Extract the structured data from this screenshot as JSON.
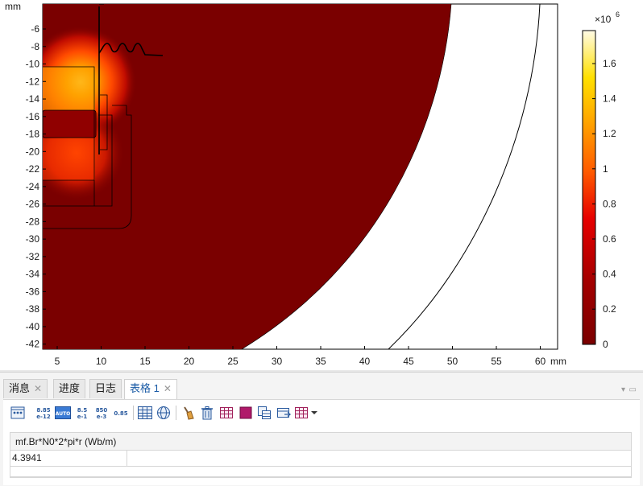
{
  "plot": {
    "axis_unit_y": "mm",
    "axis_unit_x": "mm",
    "x_ticks": [
      "5",
      "10",
      "15",
      "20",
      "25",
      "30",
      "35",
      "40",
      "45",
      "50",
      "55",
      "60"
    ],
    "y_ticks": [
      "-6",
      "-8",
      "-10",
      "-12",
      "-14",
      "-16",
      "-18",
      "-20",
      "-22",
      "-24",
      "-26",
      "-28",
      "-30",
      "-32",
      "-34",
      "-36",
      "-38",
      "-40",
      "-42"
    ],
    "colorbar": {
      "multiplier_base": "×10",
      "multiplier_exp": "6",
      "ticks": [
        "1.6",
        "1.4",
        "1.2",
        "1",
        "0.8",
        "0.6",
        "0.4",
        "0.2",
        "0"
      ],
      "colors": {
        "low": "#7a0000",
        "mid": "#ff2000",
        "high": "#ffd000",
        "top": "#fffbe0"
      }
    }
  },
  "tabs": [
    {
      "label": "消息",
      "closable": true
    },
    {
      "label": "进度",
      "closable": false
    },
    {
      "label": "日志",
      "closable": false
    },
    {
      "label": "表格 1",
      "closable": true
    }
  ],
  "toolbar_icons": [
    "table-format-icon",
    "precision-icon",
    "auto-notation-icon",
    "engineering-notation-icon",
    "scientific-notation-icon",
    "decimal-icon",
    "full-table-icon",
    "sphere-icon",
    "clear-icon",
    "delete-icon",
    "table-edit-icon",
    "color-square-icon",
    "copy-table-icon",
    "export-table-icon",
    "table-grid-icon",
    "dropdown-arrow-icon"
  ],
  "toolbar_labels": {
    "precision_top": "8.85",
    "precision_bottom": "e-12",
    "auto": "AUTO",
    "eng_top": "8.5",
    "eng_bottom": "e-1",
    "sci_top": "850",
    "sci_bottom": "e-3",
    "decimal": "0.85"
  },
  "table": {
    "header": "mf.Br*N0*2*pi*r (Wb/m)",
    "rows": [
      {
        "value": "4.3941"
      }
    ]
  }
}
